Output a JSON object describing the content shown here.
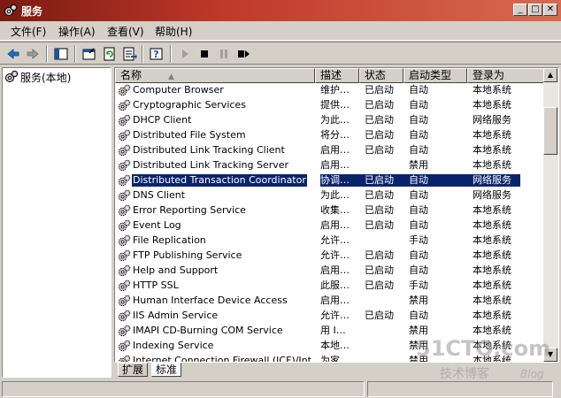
{
  "window": {
    "title": "服务"
  },
  "menu": [
    "文件(F)",
    "操作(A)",
    "查看(V)",
    "帮助(H)"
  ],
  "tree": {
    "root": "服务(本地)"
  },
  "columns": {
    "name": "名称",
    "desc": "描述",
    "status": "状态",
    "startup": "启动类型",
    "logon": "登录为"
  },
  "services": [
    {
      "name": "Computer Browser",
      "desc": "维护…",
      "status": "已启动",
      "startup": "自动",
      "logon": "本地系统"
    },
    {
      "name": "Cryptographic Services",
      "desc": "提供…",
      "status": "已启动",
      "startup": "自动",
      "logon": "本地系统"
    },
    {
      "name": "DHCP Client",
      "desc": "为此…",
      "status": "已启动",
      "startup": "自动",
      "logon": "网络服务"
    },
    {
      "name": "Distributed File System",
      "desc": "将分…",
      "status": "已启动",
      "startup": "自动",
      "logon": "本地系统"
    },
    {
      "name": "Distributed Link Tracking Client",
      "desc": "启用…",
      "status": "已启动",
      "startup": "自动",
      "logon": "本地系统"
    },
    {
      "name": "Distributed Link Tracking Server",
      "desc": "启用…",
      "status": "",
      "startup": "禁用",
      "logon": "本地系统"
    },
    {
      "name": "Distributed Transaction Coordinator",
      "desc": "协调…",
      "status": "已启动",
      "startup": "自动",
      "logon": "网络服务",
      "selected": true
    },
    {
      "name": "DNS Client",
      "desc": "为此…",
      "status": "已启动",
      "startup": "自动",
      "logon": "网络服务"
    },
    {
      "name": "Error Reporting Service",
      "desc": "收集…",
      "status": "已启动",
      "startup": "自动",
      "logon": "本地系统"
    },
    {
      "name": "Event Log",
      "desc": "启用…",
      "status": "已启动",
      "startup": "自动",
      "logon": "本地系统"
    },
    {
      "name": "File Replication",
      "desc": "允许…",
      "status": "",
      "startup": "手动",
      "logon": "本地系统"
    },
    {
      "name": "FTP Publishing Service",
      "desc": "允许…",
      "status": "已启动",
      "startup": "自动",
      "logon": "本地系统"
    },
    {
      "name": "Help and Support",
      "desc": "启用…",
      "status": "已启动",
      "startup": "自动",
      "logon": "本地系统"
    },
    {
      "name": "HTTP SSL",
      "desc": "此服…",
      "status": "已启动",
      "startup": "手动",
      "logon": "本地系统"
    },
    {
      "name": "Human Interface Device Access",
      "desc": "启用…",
      "status": "",
      "startup": "禁用",
      "logon": "本地系统"
    },
    {
      "name": "IIS Admin Service",
      "desc": "允许…",
      "status": "已启动",
      "startup": "自动",
      "logon": "本地系统"
    },
    {
      "name": "IMAPI CD-Burning COM Service",
      "desc": "用 I…",
      "status": "",
      "startup": "禁用",
      "logon": "本地系统"
    },
    {
      "name": "Indexing Service",
      "desc": "本地…",
      "status": "",
      "startup": "禁用",
      "logon": "本地系统"
    },
    {
      "name": "Internet Connection Firewall (ICF)/Int…",
      "desc": "为家…",
      "status": "",
      "startup": "禁用",
      "logon": "本地系统"
    }
  ],
  "tabs": [
    "扩展",
    "标准"
  ],
  "watermark": {
    "main": "51CTO.com",
    "sub": "技术博客",
    "blog": "Blog"
  },
  "colors": {
    "title_start": "#7a1a10",
    "title_end": "#d86a50",
    "selection": "#0a246a",
    "face": "#d4d0c8"
  }
}
